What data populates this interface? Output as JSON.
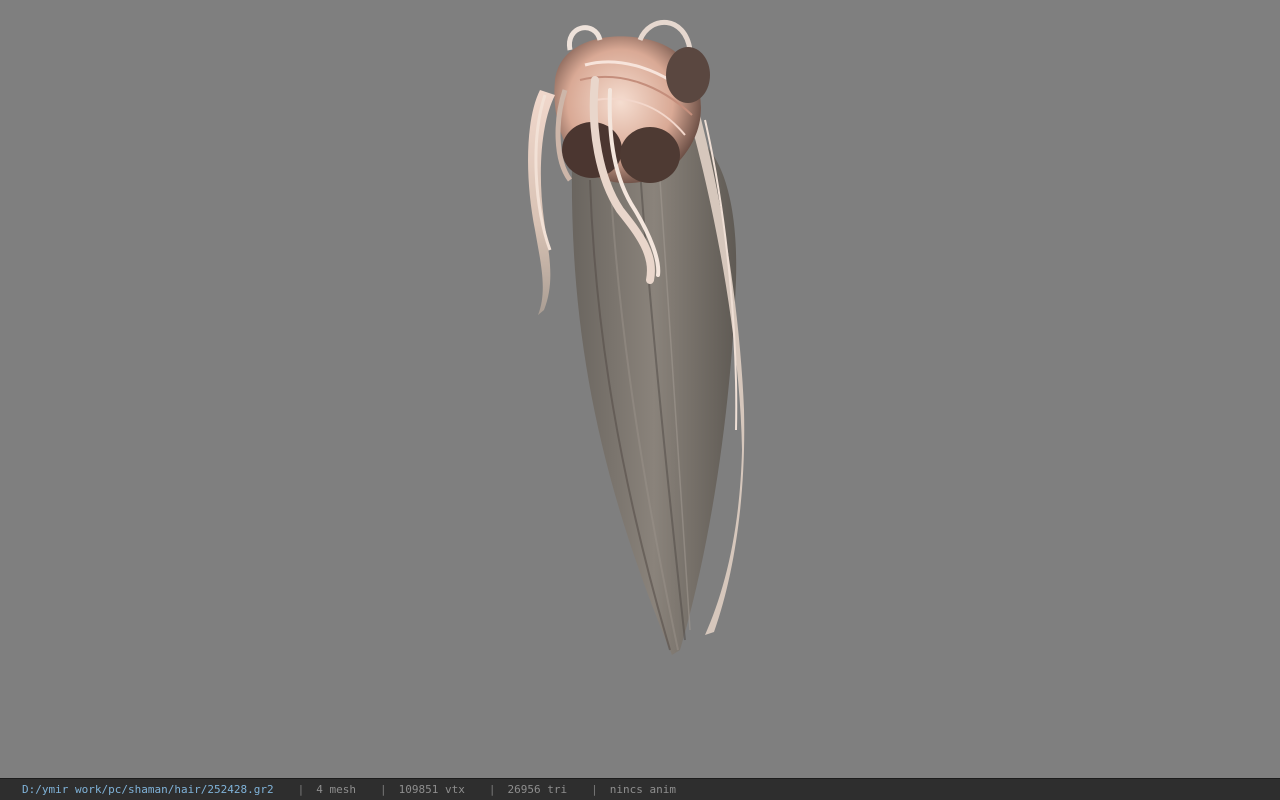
{
  "viewport": {
    "background": "#7f7f7f",
    "model": "hair-mesh"
  },
  "statusbar": {
    "file_path": "D:/ymir work/pc/shaman/hair/252428.gr2",
    "separator": "|",
    "mesh_count": "4 mesh",
    "vertex_count": "109851 vtx",
    "triangle_count": "26956 tri",
    "anim_status": "nincs anim",
    "path_color": "#7fb2d8"
  }
}
